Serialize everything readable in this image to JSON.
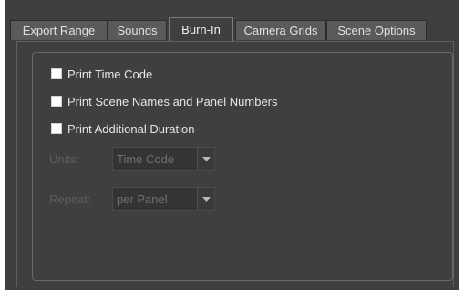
{
  "tabs": [
    {
      "label": "Export Range",
      "active": false
    },
    {
      "label": "Sounds",
      "active": false
    },
    {
      "label": "Burn-In",
      "active": true
    },
    {
      "label": "Camera Grids",
      "active": false
    },
    {
      "label": "Scene Options",
      "active": false
    }
  ],
  "checkboxes": [
    {
      "label": "Print Time Code",
      "checked": false
    },
    {
      "label": "Print Scene Names and Panel Numbers",
      "checked": false
    },
    {
      "label": "Print Additional Duration",
      "checked": false
    }
  ],
  "units": {
    "label": "Units:",
    "value": "Time Code",
    "icon": "chevron-down-icon"
  },
  "repeat": {
    "label": "Repeat:",
    "value": "per Panel",
    "icon": "chevron-down-icon"
  }
}
